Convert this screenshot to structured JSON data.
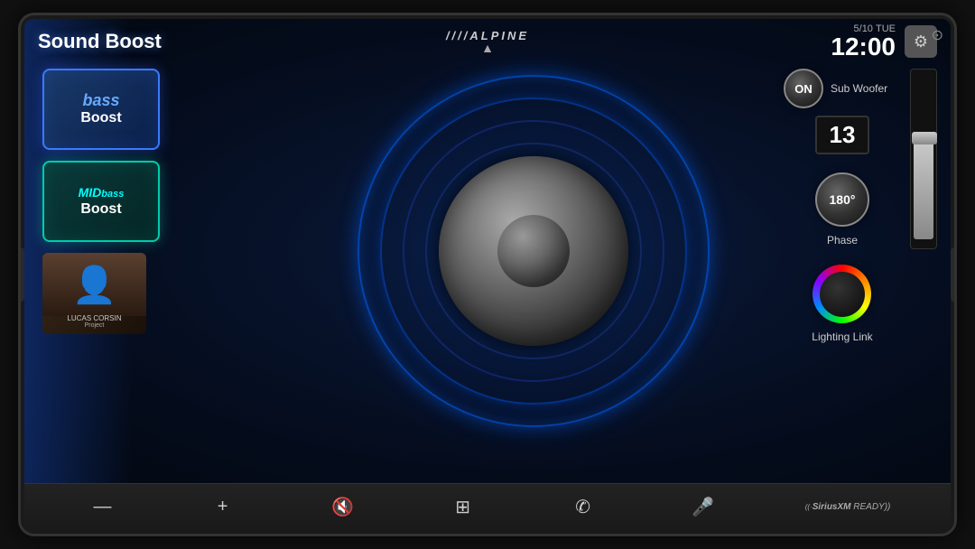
{
  "device": {
    "brand": "////ALPINE"
  },
  "header": {
    "title": "Sound Boost",
    "date": "5/10",
    "day": "TUE",
    "time": "12:00",
    "settings_label": "⚙"
  },
  "left_panel": {
    "bass_boost": {
      "label_top": "bass",
      "label_bottom": "Boost",
      "border_color": "#3a7aff"
    },
    "mid_bass_boost": {
      "label_top_1": "MID",
      "label_top_2": "bass",
      "label_bottom": "Boost",
      "border_color": "#00ccaa"
    },
    "album": {
      "artist": "LUCAS CORSIN",
      "title": "Project"
    }
  },
  "right_panel": {
    "sub_woofer": {
      "on_label": "ON",
      "section_label": "Sub Woofer",
      "value": "13"
    },
    "phase": {
      "value": "180°",
      "label": "Phase"
    },
    "lighting": {
      "label": "Lighting Link"
    }
  },
  "bottom_bar": {
    "buttons": [
      {
        "icon": "—",
        "name": "minus-button",
        "label": "minus"
      },
      {
        "icon": "+",
        "name": "plus-button",
        "label": "plus"
      },
      {
        "icon": "🔇",
        "name": "mute-button",
        "label": "mute"
      },
      {
        "icon": "⊞",
        "name": "grid-button",
        "label": "grid"
      },
      {
        "icon": "✆",
        "name": "phone-button",
        "label": "phone"
      },
      {
        "icon": "🎤",
        "name": "mic-button",
        "label": "microphone"
      }
    ],
    "siriusxm": "((·SiriusXM READY))"
  }
}
